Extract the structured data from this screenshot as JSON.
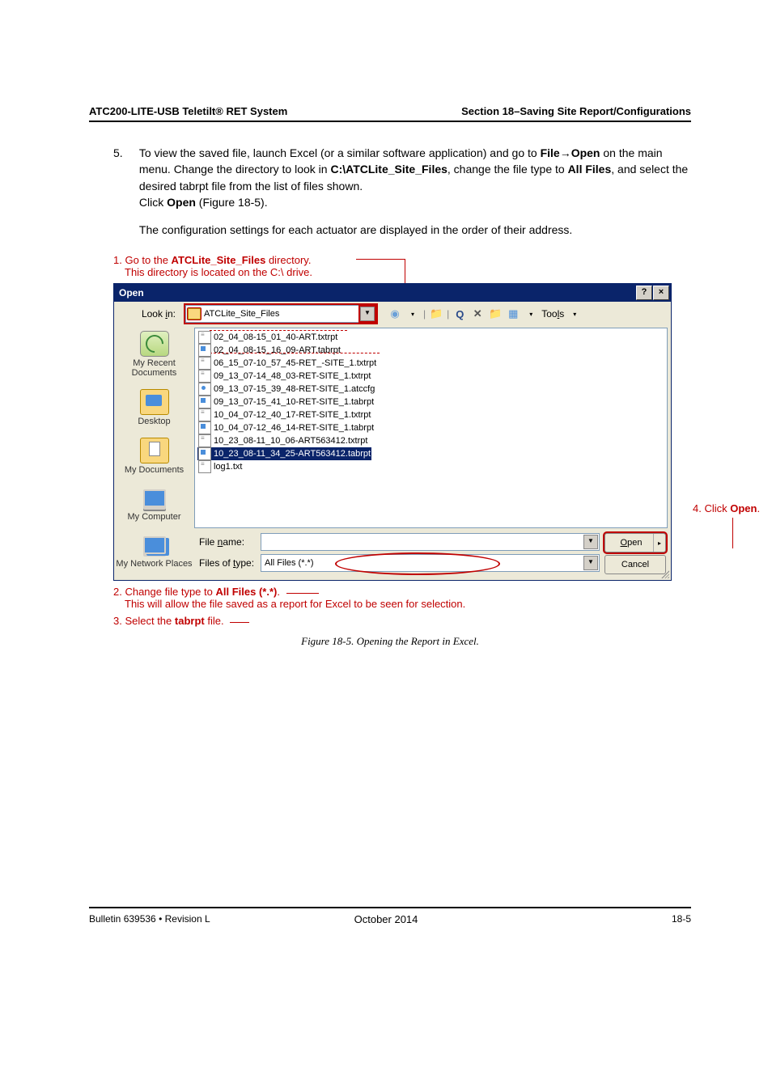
{
  "header": {
    "left": "ATC200-LITE-USB Teletilt® RET System",
    "right": "Section 18–Saving Site Report/Configurations"
  },
  "step": {
    "num": "5.",
    "line1a": "To view the saved file, launch Excel (or a similar software application) and go to ",
    "line1b": "File",
    "line1c": "→",
    "line1d": "Open",
    "line1e": " on the main menu. Change the directory to look in ",
    "line1f": "C:\\ATCLite_Site_Files",
    "line1g": ", change the file type to ",
    "line1h": "All Files",
    "line1i": ", and select the desired tabrpt file from the list of files shown.",
    "line2a": "Click ",
    "line2b": "Open",
    "line2c": " (Figure 18-5).",
    "para2": "The configuration settings for each actuator are displayed in the order of their address."
  },
  "callouts": {
    "c1a": "1. Go to the ",
    "c1b": "ATCLite_Site_Files",
    "c1c": " directory.",
    "c1d": "This directory is located on the C:\\ drive.",
    "c2a": "2. Change file type to ",
    "c2b": "All Files (*.*)",
    "c2c": ".",
    "c2d": "This will allow the file saved as a report for Excel to be seen  for selection.",
    "c3a": "3. Select the ",
    "c3b": "tabrpt",
    "c3c": " file.",
    "c4a": "4. Click ",
    "c4b": "Open",
    "c4c": "."
  },
  "dialog": {
    "title": "Open",
    "help_btn": "?",
    "close_btn": "×",
    "lookin_label": "Look in:",
    "lookin_value": "ATCLite_Site_Files",
    "tools_label": "Tools",
    "places": {
      "recent": "My Recent Documents",
      "desktop": "Desktop",
      "mydocs": "My Documents",
      "computer": "My Computer",
      "network": "My Network Places"
    },
    "files": [
      {
        "name": "02_04_08-15_01_40-ART.txtrpt",
        "type": "txt"
      },
      {
        "name": "02_04_08-15_16_09-ART.tabrpt",
        "type": "tab"
      },
      {
        "name": "06_15_07-10_57_45-RET_-SITE_1.txtrpt",
        "type": "txt"
      },
      {
        "name": "09_13_07-14_48_03-RET-SITE_1.txtrpt",
        "type": "txt"
      },
      {
        "name": "09_13_07-15_39_48-RET-SITE_1.atccfg",
        "type": "cfg"
      },
      {
        "name": "09_13_07-15_41_10-RET-SITE_1.tabrpt",
        "type": "tab"
      },
      {
        "name": "10_04_07-12_40_17-RET-SITE_1.txtrpt",
        "type": "txt"
      },
      {
        "name": "10_04_07-12_46_14-RET-SITE_1.tabrpt",
        "type": "tab"
      },
      {
        "name": "10_23_08-11_10_06-ART563412.txtrpt",
        "type": "txt"
      },
      {
        "name": "10_23_08-11_34_25-ART563412.tabrpt",
        "type": "tab",
        "selected": true
      },
      {
        "name": "log1.txt",
        "type": "txt"
      }
    ],
    "filename_label": "File name:",
    "filename_value": "",
    "filetype_label": "Files of type:",
    "filetype_value": "All Files (*.*)",
    "open_btn": "Open",
    "cancel_btn": "Cancel"
  },
  "figure_caption": "Figure 18-5. Opening the Report in Excel.",
  "footer": {
    "left": "Bulletin 639536  •  Revision L",
    "center": "October 2014",
    "right": "18-5"
  }
}
